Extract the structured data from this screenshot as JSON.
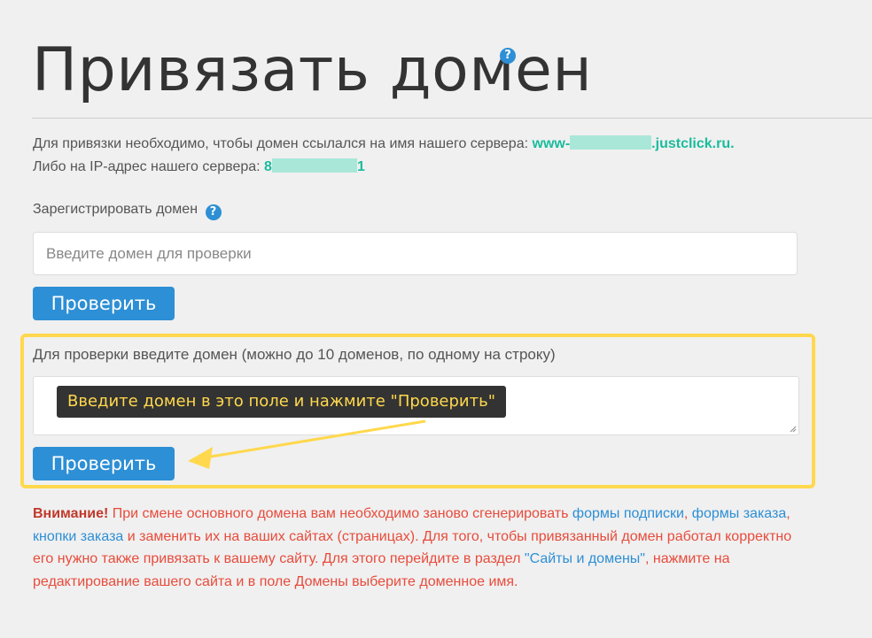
{
  "page_title": "Привязать домен",
  "help_glyph": "?",
  "info": {
    "line1_text": "Для привязки необходимо, чтобы домен ссылался на имя нашего сервера: ",
    "server_prefix": "www-",
    "server_suffix": ".justclick.ru.",
    "line2_text": "Либо на IP-адрес нашего сервера: ",
    "ip_prefix": "8",
    "ip_suffix": "1"
  },
  "register": {
    "label": "Зарегистрировать домен",
    "placeholder": "Введите домен для проверки",
    "button": "Проверить"
  },
  "check": {
    "label": "Для проверки введите домен (можно до 10 доменов, по одному на строку)",
    "tooltip": "Введите домен в это поле и нажмите \"Проверить\"",
    "button": "Проверить"
  },
  "warning": {
    "bold": "Внимание!",
    "t1": " При смене основного домена вам необходимо заново сгенерировать ",
    "link1": "формы подписки",
    "t2": ", ",
    "link2": "формы заказа",
    "t3": ", ",
    "link3": "кнопки заказа",
    "t4": " и заменить их на ваших сайтах (страницах). Для того, чтобы привязанный домен работал корректно его нужно также привязать к вашему сайту. Для этого перейдите в раздел ",
    "link4": "\"Сайты и домены\"",
    "t5": ", нажмите на редактирование вашего сайта и в поле Домены выберите доменное имя."
  },
  "colors": {
    "accent": "#2d8fd5",
    "highlight": "#ffd84d",
    "server_green": "#1abc9c",
    "warning_red": "#e74c3c"
  }
}
